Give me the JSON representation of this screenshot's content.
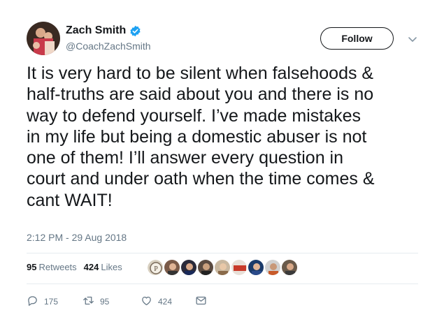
{
  "author": {
    "display_name": "Zach Smith",
    "handle": "@CoachZachSmith",
    "verified": true
  },
  "follow_label": "Follow",
  "tweet_text": "It is very hard to be silent when falsehoods &\nhalf-truths are said about you and there is no\nway to defend yourself.  I’ve made mistakes\nin my life but being a domestic abuser is not\none of them! I’ll answer every question in\ncourt and under oath when the time comes &\ncant WAIT!",
  "timestamp": "2:12 PM - 29 Aug 2018",
  "stats": {
    "retweets_count": "95",
    "retweets_label": "Retweets",
    "likes_count": "424",
    "likes_label": "Likes"
  },
  "actions": {
    "replies": "175",
    "retweets": "95",
    "likes": "424"
  },
  "colors": {
    "text": "#14171a",
    "secondary": "#657786",
    "verified": "#1da1f2",
    "divider": "#e6ecf0"
  },
  "icons": [
    "verified-badge-icon",
    "chevron-down-icon",
    "reply-icon",
    "retweet-icon",
    "like-icon",
    "direct-message-icon"
  ]
}
